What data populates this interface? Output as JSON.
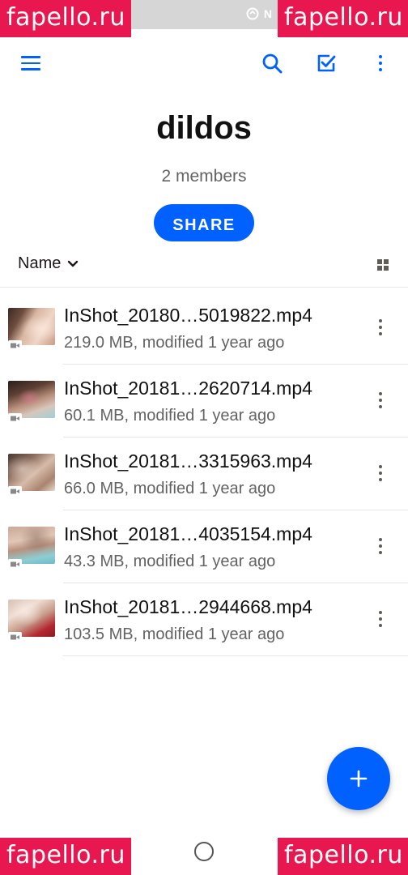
{
  "status_bar": {
    "icons": [
      "nfc-icon",
      "network-icon"
    ],
    "nfc_glyph": "N"
  },
  "toolbar": {
    "menu_icon": "hamburger-menu-icon",
    "search_icon": "search-icon",
    "select_icon": "checkbox-select-icon",
    "more_icon": "more-vertical-icon"
  },
  "folder": {
    "title": "dildos",
    "members": "2 members",
    "share_label": "SHARE"
  },
  "sort": {
    "label": "Name",
    "chevron_icon": "chevron-down-icon",
    "view_toggle_icon": "grid-view-icon"
  },
  "files": [
    {
      "name": "InShot_20180…5019822.mp4",
      "meta": "219.0 MB, modified 1 year ago"
    },
    {
      "name": "InShot_20181…2620714.mp4",
      "meta": "60.1 MB, modified 1 year ago"
    },
    {
      "name": "InShot_20181…3315963.mp4",
      "meta": "66.0 MB, modified 1 year ago"
    },
    {
      "name": "InShot_20181…4035154.mp4",
      "meta": "43.3 MB, modified 1 year ago"
    },
    {
      "name": "InShot_20181…2944668.mp4",
      "meta": "103.5 MB, modified 1 year ago"
    }
  ],
  "fab": {
    "icon": "plus-icon"
  },
  "watermarks": {
    "top_left": "fapello.ru",
    "top_right": "fapello.ru",
    "bottom_left": "fapello.ru",
    "bottom_right": "fapello.ru"
  },
  "colors": {
    "accent": "#0061fe",
    "watermark": "#e8174f",
    "secondary_text": "#636363"
  }
}
